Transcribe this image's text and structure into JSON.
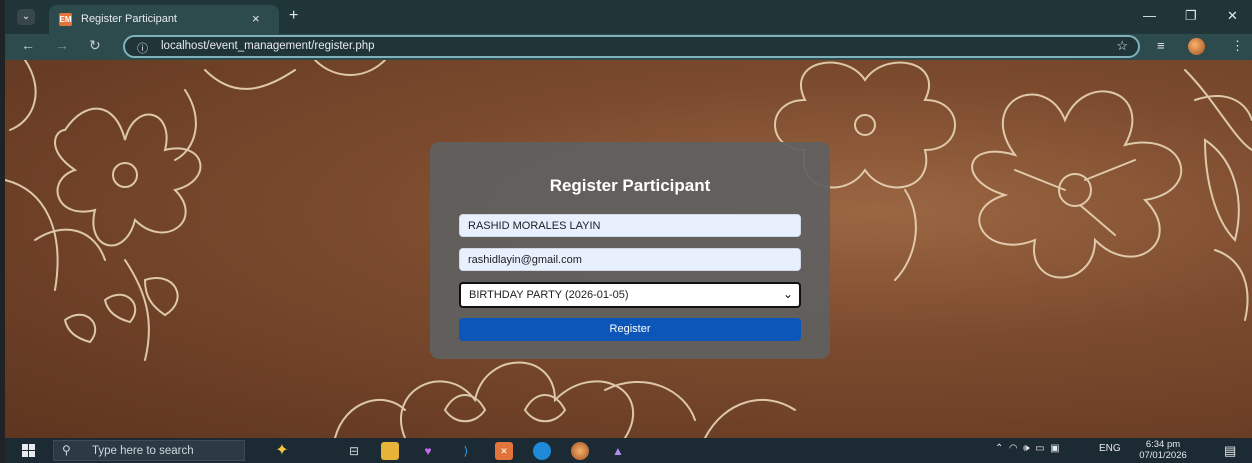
{
  "browser": {
    "tab_title": "Register Participant",
    "tab_close": "×",
    "new_tab": "+",
    "url": "localhost/event_management/register.php",
    "window_controls": {
      "minimize": "—",
      "restore": "❐",
      "close": "✕"
    },
    "favicon_text": "EM"
  },
  "form": {
    "title": "Register Participant",
    "name_value": "RASHID MORALES LAYIN",
    "email_value": "rashidlayin@gmail.com",
    "event_selected": "BIRTHDAY PARTY (2026-01-05)",
    "submit_label": "Register"
  },
  "taskbar": {
    "search_placeholder": "Type here to search",
    "tray_language": "ENG",
    "time": "6:34 pm",
    "date": "07/01/2026"
  },
  "colors": {
    "button_blue": "#0b56b8",
    "card_bg": "#606060",
    "field_bg": "#e8f0fe",
    "tab_strip": "#1f3538",
    "toolbar": "#2d4a4d"
  }
}
